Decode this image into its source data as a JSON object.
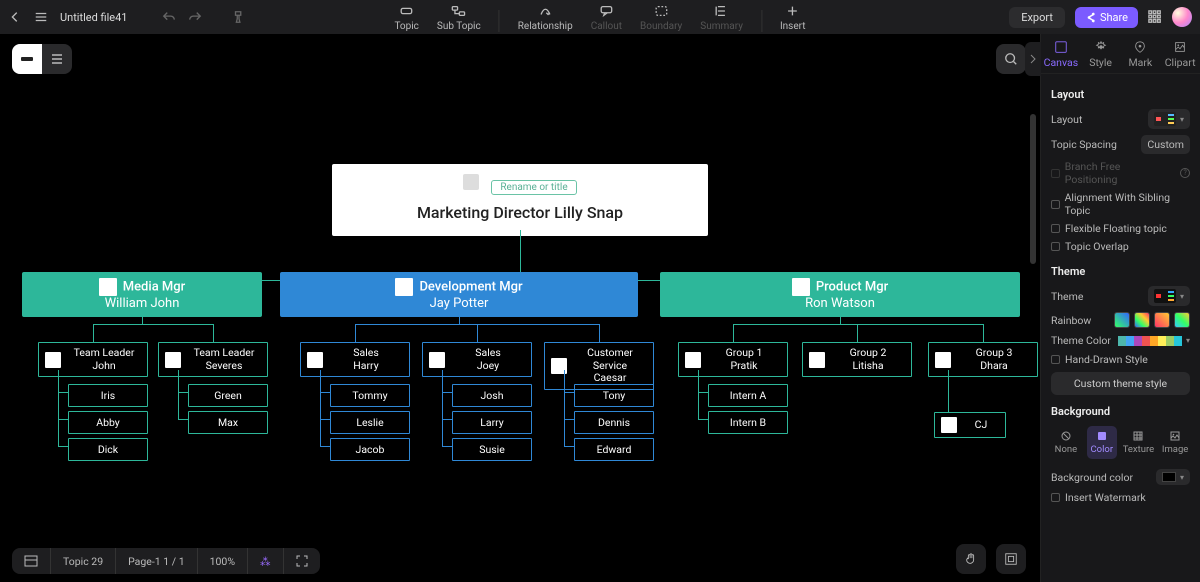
{
  "header": {
    "filename": "Untitled file41",
    "tools": [
      {
        "id": "topic",
        "label": "Topic",
        "enabled": true
      },
      {
        "id": "subtopic",
        "label": "Sub Topic",
        "enabled": true
      },
      {
        "id": "relationship",
        "label": "Relationship",
        "enabled": true
      },
      {
        "id": "callout",
        "label": "Callout",
        "enabled": false
      },
      {
        "id": "boundary",
        "label": "Boundary",
        "enabled": false
      },
      {
        "id": "summary",
        "label": "Summary",
        "enabled": false
      },
      {
        "id": "insert",
        "label": "Insert",
        "enabled": true
      }
    ],
    "export_label": "Export",
    "share_label": "Share"
  },
  "chart_data": {
    "type": "org-chart",
    "root": {
      "title": "Marketing Director Lilly Snap",
      "chip": "Rename or title"
    },
    "managers": [
      {
        "role": "Media Mgr",
        "name": "William John",
        "color": "green",
        "teams": [
          {
            "role": "Team Leader",
            "name": "John",
            "members": [
              "Iris",
              "Abby",
              "Dick"
            ]
          },
          {
            "role": "Team Leader",
            "name": "Severes",
            "members": [
              "Green",
              "Max"
            ]
          }
        ]
      },
      {
        "role": "Development Mgr",
        "name": "Jay Potter",
        "color": "blue",
        "teams": [
          {
            "role": "Sales",
            "name": "Harry",
            "members": [
              "Tommy",
              "Leslie",
              "Jacob"
            ]
          },
          {
            "role": "Sales",
            "name": "Joey",
            "members": [
              "Josh",
              "Larry",
              "Susie"
            ]
          },
          {
            "role": "Customer Service",
            "name": "Caesar",
            "members": [
              "Tony",
              "Dennis",
              "Edward"
            ]
          }
        ]
      },
      {
        "role": "Product Mgr",
        "name": "Ron Watson",
        "color": "green",
        "teams": [
          {
            "role": "Group 1",
            "name": "Pratik",
            "members": [
              "Intern A",
              "Intern B"
            ]
          },
          {
            "role": "Group 2",
            "name": "Litisha",
            "members": []
          },
          {
            "role": "Group 3",
            "name": "Dhara",
            "members": [
              "CJ"
            ]
          }
        ]
      }
    ]
  },
  "panel": {
    "tabs": [
      "Canvas",
      "Style",
      "Mark",
      "Clipart"
    ],
    "active_tab": 0,
    "layout": {
      "title": "Layout",
      "layout_label": "Layout",
      "spacing_label": "Topic Spacing",
      "spacing_value": "Custom",
      "options": [
        {
          "label": "Branch Free Positioning",
          "disabled": true,
          "info": true
        },
        {
          "label": "Alignment With Sibling Topic"
        },
        {
          "label": "Flexible Floating topic"
        },
        {
          "label": "Topic Overlap"
        }
      ]
    },
    "theme": {
      "title": "Theme",
      "theme_label": "Theme",
      "rainbow_label": "Rainbow",
      "theme_color_label": "Theme Color",
      "theme_colors": [
        "#4db6ac",
        "#42a5f5",
        "#ab47bc",
        "#ef5350",
        "#ffa726",
        "#ffee58",
        "#9ccc65",
        "#26c6da"
      ],
      "handdrawn_label": "Hand-Drawn Style",
      "custom_btn": "Custom theme style"
    },
    "background": {
      "title": "Background",
      "options": [
        "None",
        "Color",
        "Texture",
        "Image"
      ],
      "active": 1,
      "bgcolor_label": "Background color",
      "watermark_label": "Insert Watermark"
    }
  },
  "status": {
    "topic": "Topic  29",
    "page": "Page-1   1 / 1",
    "zoom": "100%"
  }
}
